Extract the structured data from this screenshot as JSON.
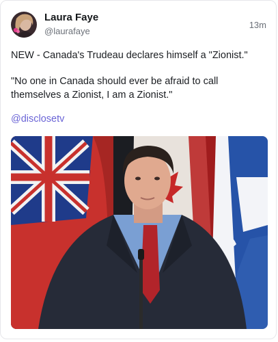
{
  "post": {
    "author_name": "Laura Faye",
    "author_handle": "@laurafaye",
    "timestamp": "13m",
    "text_line1": "NEW - Canada's Trudeau declares himself a \"Zionist.\"",
    "text_line2": "\"No one in Canada should ever be afraid to call themselves a Zionist, I am a Zionist.\"",
    "link": "@disclosetv",
    "media_icon": "video-still-image"
  },
  "colors": {
    "link": "#6a64d6",
    "muted_text": "#6b7078",
    "border": "#e6e6ea"
  }
}
